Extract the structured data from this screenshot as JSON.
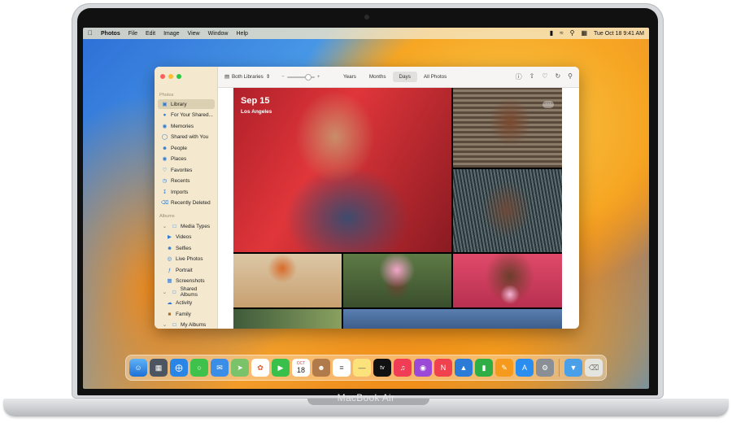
{
  "device": {
    "brand": "MacBook Air"
  },
  "menubar": {
    "app": "Photos",
    "items": [
      "File",
      "Edit",
      "Image",
      "View",
      "Window",
      "Help"
    ],
    "clock": "Tue Oct 18  9:41 AM"
  },
  "toolbar": {
    "library_label": "Both Libraries",
    "views": [
      "Years",
      "Months",
      "Days",
      "All Photos"
    ],
    "active_view": "Days"
  },
  "sidebar": {
    "section_photos": "Photos",
    "items": [
      {
        "label": "Library",
        "icon": "photo-icon"
      },
      {
        "label": "For Your Shared...",
        "icon": "people-icon"
      },
      {
        "label": "Memories",
        "icon": "memories-icon"
      },
      {
        "label": "Shared with You",
        "icon": "shared-icon"
      },
      {
        "label": "People",
        "icon": "person-icon"
      },
      {
        "label": "Places",
        "icon": "map-pin-icon"
      },
      {
        "label": "Favorites",
        "icon": "heart-icon"
      },
      {
        "label": "Recents",
        "icon": "clock-icon"
      },
      {
        "label": "Imports",
        "icon": "import-icon"
      },
      {
        "label": "Recently Deleted",
        "icon": "trash-icon"
      }
    ],
    "section_albums": "Albums",
    "media_types": "Media Types",
    "media_items": [
      "Videos",
      "Selfies",
      "Live Photos",
      "Portrait",
      "Screenshots"
    ],
    "shared_albums": "Shared Albums",
    "shared_items": [
      "Activity",
      "Family"
    ],
    "my_albums": "My Albums"
  },
  "grid": {
    "date": "Sep 15",
    "location": "Los Angeles"
  },
  "dock": {
    "calendar_month": "OCT",
    "calendar_day": "18",
    "tv_label": "tv"
  }
}
